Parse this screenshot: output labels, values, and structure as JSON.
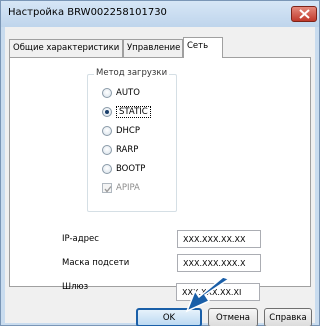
{
  "window": {
    "title": "Настройка BRW002258101730",
    "accent_color": "#1a5fa8",
    "titlebar_color": "#c9dcef",
    "close_color": "#c0392b"
  },
  "tabs": [
    {
      "label": "Общие характеристики",
      "active": false
    },
    {
      "label": "Управление",
      "active": false
    },
    {
      "label": "Сеть",
      "active": true
    }
  ],
  "boot_method": {
    "legend": "Метод загрузки",
    "options": [
      {
        "label": "AUTO",
        "selected": false
      },
      {
        "label": "STATIC",
        "selected": true
      },
      {
        "label": "DHCP",
        "selected": false
      },
      {
        "label": "RARP",
        "selected": false
      },
      {
        "label": "BOOTP",
        "selected": false
      }
    ],
    "apipa": {
      "label": "APIPA",
      "checked": true,
      "disabled": true
    }
  },
  "fields": [
    {
      "label": "IP-адрес",
      "value": "XXX.XXX.XX.XX"
    },
    {
      "label": "Маска подсети",
      "value": "XXX.XXX.XXX.X"
    },
    {
      "label": "Шлюз",
      "value": "XXX.XXX.XX.XI"
    }
  ],
  "buttons": {
    "ok": "OK",
    "cancel": "Отмена",
    "help": "Справка"
  },
  "icons": {
    "close": "close-icon",
    "pointer_arrow": "arrow-icon",
    "checkmark": "checkmark-icon"
  }
}
